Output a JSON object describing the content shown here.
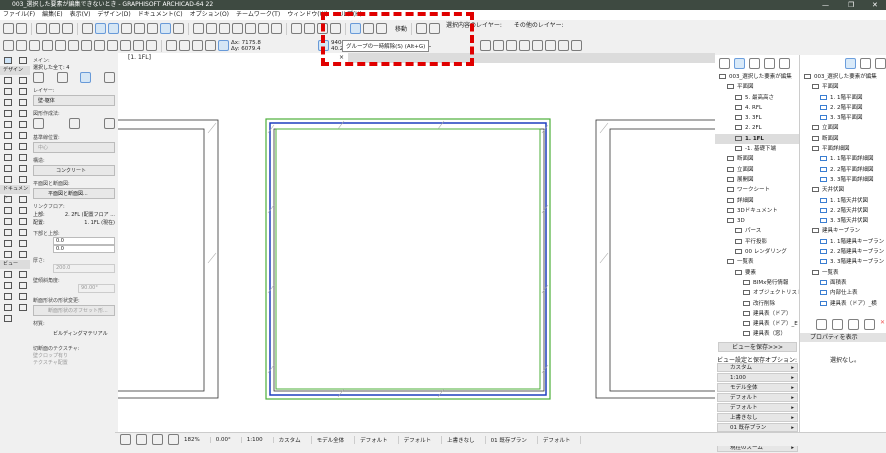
{
  "window": {
    "title": "003_選択した要素が編集できないとき - GRAPHISOFT ARCHICAD-64 22",
    "min": "—",
    "restore": "❐",
    "close": "✕"
  },
  "menu": [
    "ファイル(F)",
    "編集(E)",
    "表示(V)",
    "デザイン(D)",
    "ドキュメント(C)",
    "オプション(O)",
    "チームワーク(T)",
    "ウィンドウ(W)",
    "ヘルプ(H)"
  ],
  "toolbar": {
    "x_coord": "Δx: 7175.8",
    "y_coord": "Δy: 6079.4",
    "r_coord": "9404.8",
    "angle": "40.27°",
    "gl": "GL",
    "move": "移動",
    "sel_layer": "選択内容のレイヤー:",
    "other_layer": "その他のレイヤー:"
  },
  "tooltip": "グループの一時解除(S) (Alt+G)",
  "tab": {
    "label": "[1. 1FL]",
    "close": "×"
  },
  "toolbox": {
    "design": "デザイン",
    "document": "ドキュメント",
    "view": "ビュー"
  },
  "info": {
    "main": "メイン:",
    "selected": "選択した全て: 4",
    "layer_label": "レイヤー:",
    "layer": "壁-躯体",
    "geom": "図形作成法:",
    "ref_label": "基準線位置:",
    "ref": "中心",
    "struct_label": "構造:",
    "struct": "コンクリート",
    "plan_label": "平面図と断面図:",
    "plan": "平面図と断面図...",
    "link_label": "リンクフロア:",
    "top_label": "上部:",
    "top": "2. 2FL (配置フロア ...",
    "home_label": "配置:",
    "home": "1. 1FL (現在)",
    "offset_label": "下部と上部:",
    "off1": "0.0",
    "off2": "0.0",
    "thick_label": "厚さ:",
    "thick": "200.0",
    "angle_label": "壁傾斜角度:",
    "angle": "90.00°",
    "profile_label": "断面形状の形状変更:",
    "profile": "断面形状のオフセット形...",
    "mat_label": "材質:",
    "mat": "ビルディングマテリアル",
    "tex_label": "切断面のテクスチャ:",
    "crop": "壁クロップ有り",
    "tex": "テクスチャ配置"
  },
  "navL": [
    {
      "t": "003_選択した要素が編集",
      "l": 0
    },
    {
      "t": "平面図",
      "l": 1
    },
    {
      "t": "5. 最高高さ",
      "l": 2
    },
    {
      "t": "4. RFL",
      "l": 2
    },
    {
      "t": "3. 3FL",
      "l": 2
    },
    {
      "t": "2. 2FL",
      "l": 2
    },
    {
      "t": "1. 1FL",
      "l": 2,
      "sel": true
    },
    {
      "t": "-1. 基礎下端",
      "l": 2
    },
    {
      "t": "断面図",
      "l": 1
    },
    {
      "t": "立面図",
      "l": 1
    },
    {
      "t": "展開図",
      "l": 1
    },
    {
      "t": "ワークシート",
      "l": 1
    },
    {
      "t": "詳細図",
      "l": 1
    },
    {
      "t": "3Dドキュメント",
      "l": 1
    },
    {
      "t": "3D",
      "l": 1
    },
    {
      "t": "パース",
      "l": 2
    },
    {
      "t": "平行投影",
      "l": 2
    },
    {
      "t": "00 レンダリング",
      "l": 2
    },
    {
      "t": "一覧表",
      "l": 1
    },
    {
      "t": "要素",
      "l": 2
    },
    {
      "t": "BIMx発行情報",
      "l": 3
    },
    {
      "t": "オブジェクトリスト",
      "l": 3
    },
    {
      "t": "改行削除",
      "l": 3
    },
    {
      "t": "建具表（ドア）",
      "l": 3
    },
    {
      "t": "建具表（ドア）_E",
      "l": 3
    },
    {
      "t": "建具表（窓）",
      "l": 3
    }
  ],
  "navR": [
    {
      "t": "003_選択した要素が編集",
      "l": 0
    },
    {
      "t": "平面図",
      "l": 1
    },
    {
      "t": "1. 1階平面図",
      "l": 2
    },
    {
      "t": "2. 2階平面図",
      "l": 2
    },
    {
      "t": "3. 3階平面図",
      "l": 2
    },
    {
      "t": "立面図",
      "l": 1
    },
    {
      "t": "断面図",
      "l": 1
    },
    {
      "t": "平面詳細図",
      "l": 1
    },
    {
      "t": "1. 1階平面詳細図",
      "l": 2
    },
    {
      "t": "2. 2階平面詳細図",
      "l": 2
    },
    {
      "t": "3. 3階平面詳細図",
      "l": 2
    },
    {
      "t": "天井伏図",
      "l": 1
    },
    {
      "t": "1. 1階天井伏図",
      "l": 2
    },
    {
      "t": "2. 2階天井伏図",
      "l": 2
    },
    {
      "t": "3. 3階天井伏図",
      "l": 2
    },
    {
      "t": "建具キープラン",
      "l": 1
    },
    {
      "t": "1. 1階建具キープラン",
      "l": 2
    },
    {
      "t": "2. 2階建具キープラン",
      "l": 2
    },
    {
      "t": "3. 3階建具キープラン",
      "l": 2
    },
    {
      "t": "一覧表",
      "l": 1
    },
    {
      "t": "面積表",
      "l": 2
    },
    {
      "t": "内部仕上表",
      "l": 2
    },
    {
      "t": "建具表（ドア）_横",
      "l": 2
    }
  ],
  "save_view": "ビューを保存>>>",
  "view_opts_label": "ビュー設定と保存オプション:",
  "view_opts": [
    "カスタム",
    "1:100",
    "モデル全体",
    "デフォルト",
    "デフォルト",
    "上書きなし",
    "01 既存プラン",
    "デフォルト",
    "現在のズーム"
  ],
  "props": {
    "header": "プロパティを表示",
    "none": "選択なし。"
  },
  "status": [
    "182%",
    "0.00°",
    "1:100",
    "カスタム",
    "モデル全体",
    "デフォルト",
    "デフォルト",
    "上書きなし",
    "01 既存プラン",
    "デフォルト"
  ],
  "colors": {
    "green": "#4caf3a",
    "blue": "#1f3fbf",
    "highlight": "#e00000"
  }
}
